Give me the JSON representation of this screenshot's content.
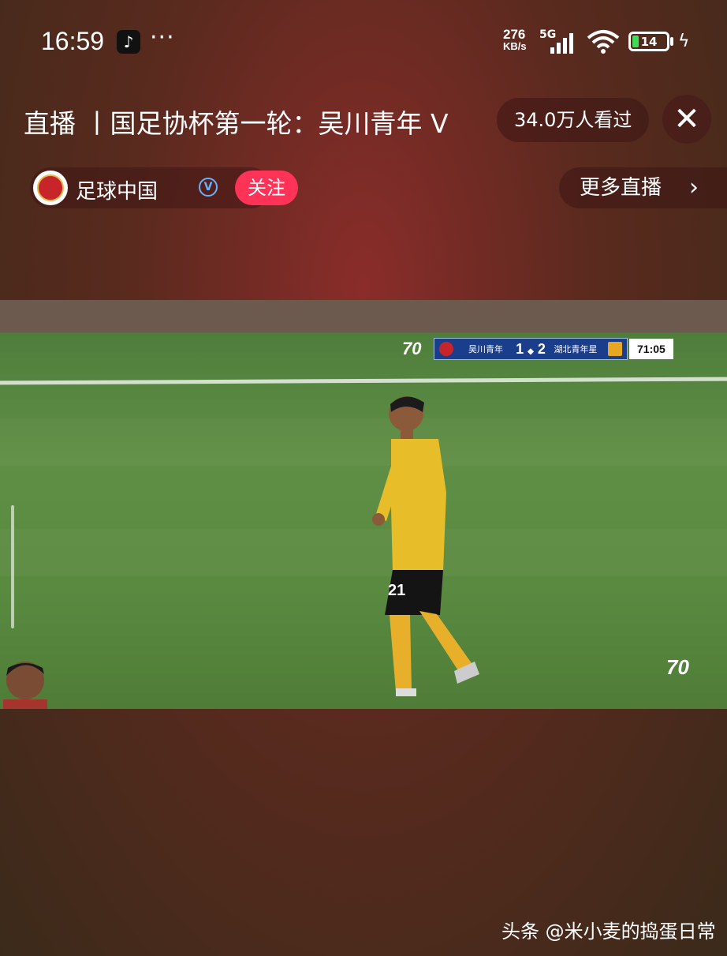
{
  "status_bar": {
    "time": "16:59",
    "app_icon": "tiktok-icon",
    "more_dots": "···",
    "net_speed_value": "276",
    "net_speed_unit": "KB/s",
    "network": "5G",
    "battery": "14"
  },
  "header": {
    "title": "直播 丨国足协杯第一轮：吴川青年 V",
    "views": "34.0万人看过",
    "close_icon": "close-icon"
  },
  "channel": {
    "name": "足球中国",
    "verified_badge": "V",
    "follow_label": "关注",
    "more_live_label": "更多直播",
    "more_live_chevron": "›"
  },
  "scoreboard": {
    "logo": "70",
    "home_team": "吴川青年",
    "home_score": "1",
    "away_score": "2",
    "away_team": "湖北青年星",
    "match_clock": "71:05",
    "home_color": "#c8252b",
    "away_color": "#e6a723"
  },
  "video": {
    "corner_logo": "70"
  },
  "watermark": "头条 @米小麦的捣蛋日常"
}
